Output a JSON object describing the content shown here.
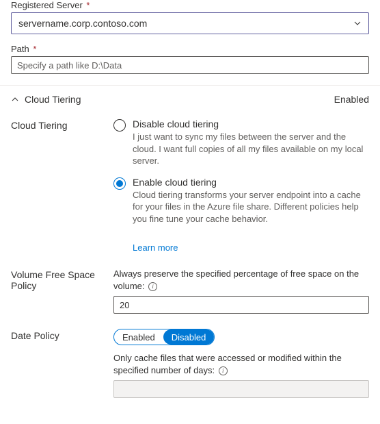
{
  "fields": {
    "registeredServer": {
      "label": "Registered Server",
      "required": "*",
      "value": "servername.corp.contoso.com"
    },
    "path": {
      "label": "Path",
      "required": "*",
      "placeholder": "Specify a path like D:\\Data"
    }
  },
  "cloudTiering": {
    "sectionTitle": "Cloud Tiering",
    "status": "Enabled",
    "label": "Cloud Tiering",
    "options": {
      "disable": {
        "title": "Disable cloud tiering",
        "desc": "I just want to sync my files between the server and the cloud. I want full copies of all my files available on my local server."
      },
      "enable": {
        "title": "Enable cloud tiering",
        "desc": "Cloud tiering transforms your server endpoint into a cache for your files in the Azure file share. Different policies help you fine tune your cache behavior."
      }
    },
    "learnMore": "Learn more"
  },
  "volumePolicy": {
    "label": "Volume Free Space Policy",
    "desc": "Always preserve the specified percentage of free space on the volume:",
    "value": "20"
  },
  "datePolicy": {
    "label": "Date Policy",
    "toggle": {
      "enabled": "Enabled",
      "disabled": "Disabled"
    },
    "desc": "Only cache files that were accessed or modified within the specified number of days:",
    "value": ""
  },
  "icons": {
    "info": "i"
  }
}
